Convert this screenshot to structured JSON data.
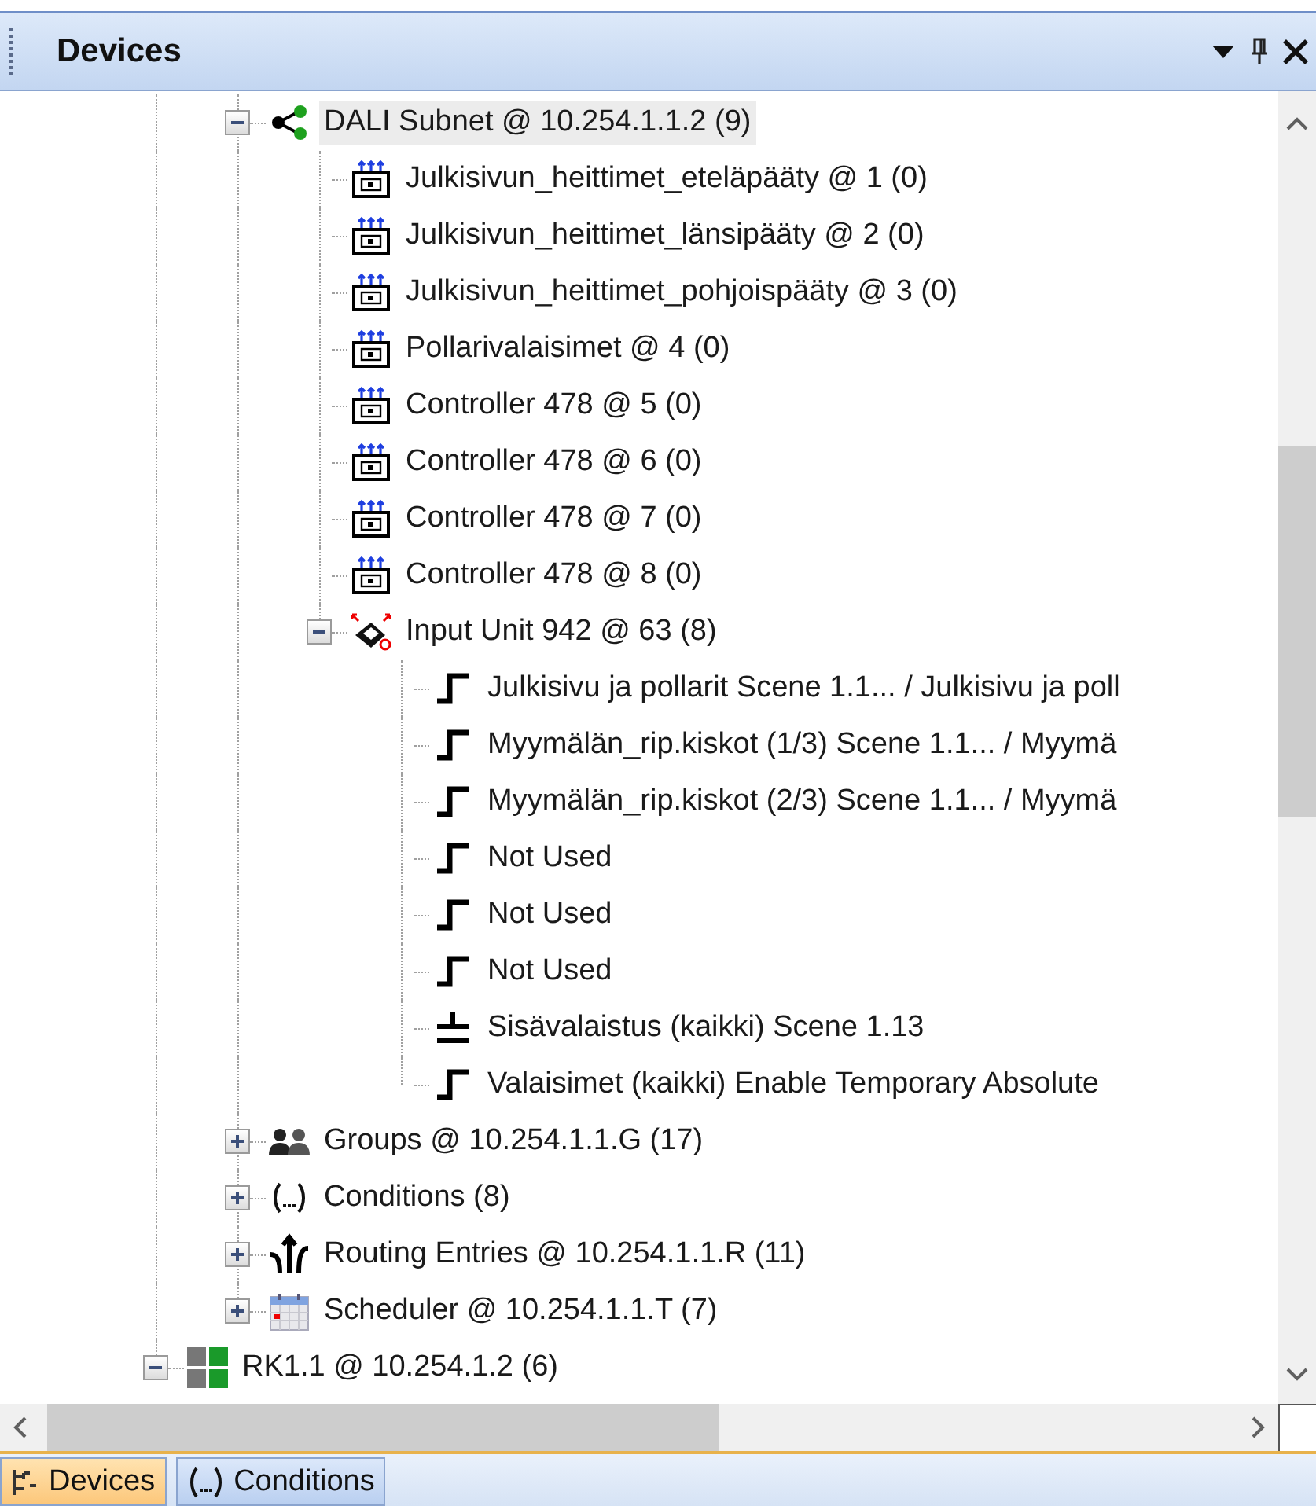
{
  "panel": {
    "title": "Devices"
  },
  "tree": [
    {
      "children": [
        {
          "label": "DALI Subnet @ 10.254.1.1.2 (9)",
          "kind": "subnet",
          "expanded": true,
          "selected": true,
          "children": [
            {
              "label": "Julkisivun_heittimet_eteläpääty @ 1 (0)",
              "kind": "dali-device",
              "selected": false
            },
            {
              "label": "Julkisivun_heittimet_länsipääty @ 2 (0)",
              "kind": "dali-device",
              "selected": false
            },
            {
              "label": "Julkisivun_heittimet_pohjoispääty @ 3 (0)",
              "kind": "dali-device",
              "selected": false
            },
            {
              "label": "Pollarivalaisimet @ 4 (0)",
              "kind": "dali-device",
              "selected": false
            },
            {
              "label": "Controller 478 @ 5 (0)",
              "kind": "dali-device",
              "selected": false
            },
            {
              "label": "Controller 478 @ 6 (0)",
              "kind": "dali-device",
              "selected": false
            },
            {
              "label": "Controller 478 @ 7 (0)",
              "kind": "dali-device",
              "selected": false
            },
            {
              "label": "Controller 478 @ 8 (0)",
              "kind": "dali-device",
              "selected": false
            },
            {
              "label": "Input Unit 942 @ 63 (8)",
              "kind": "input-unit",
              "expanded": true,
              "selected": false,
              "children": [
                {
                  "label": "Julkisivu ja pollarit Scene 1.1... / Julkisivu ja poll",
                  "kind": "step",
                  "selected": false
                },
                {
                  "label": "Myymälän_rip.kiskot (1/3) Scene 1.1... / Myymä",
                  "kind": "step",
                  "selected": false
                },
                {
                  "label": "Myymälän_rip.kiskot (2/3) Scene 1.1... / Myymä",
                  "kind": "step",
                  "selected": false
                },
                {
                  "label": " Not Used",
                  "kind": "step",
                  "selected": false
                },
                {
                  "label": " Not Used",
                  "kind": "step",
                  "selected": false
                },
                {
                  "label": " Not Used",
                  "kind": "step",
                  "selected": false
                },
                {
                  "label": "Sisävalaistus (kaikki) Scene 1.13",
                  "kind": "toggle",
                  "selected": false
                },
                {
                  "label": "Valaisimet (kaikki) Enable Temporary Absolute",
                  "kind": "step",
                  "selected": false
                }
              ]
            }
          ]
        },
        {
          "label": "Groups @ 10.254.1.1.G (17)",
          "kind": "groups",
          "expanded": false,
          "selected": false
        },
        {
          "label": "Conditions (8)",
          "kind": "conditions",
          "expanded": false,
          "selected": false
        },
        {
          "label": "Routing Entries @ 10.254.1.1.R (11)",
          "kind": "routing",
          "expanded": false,
          "selected": false
        },
        {
          "label": "Scheduler @ 10.254.1.1.T (7)",
          "kind": "scheduler",
          "expanded": false,
          "selected": false
        }
      ]
    },
    {
      "label": "RK1.1 @ 10.254.1.2 (6)",
      "kind": "controller",
      "expanded": true,
      "selected": false
    }
  ],
  "tabs": [
    {
      "label": "Devices",
      "kind": "devices",
      "selected": true
    },
    {
      "label": "Conditions",
      "kind": "conditions",
      "selected": false
    }
  ]
}
